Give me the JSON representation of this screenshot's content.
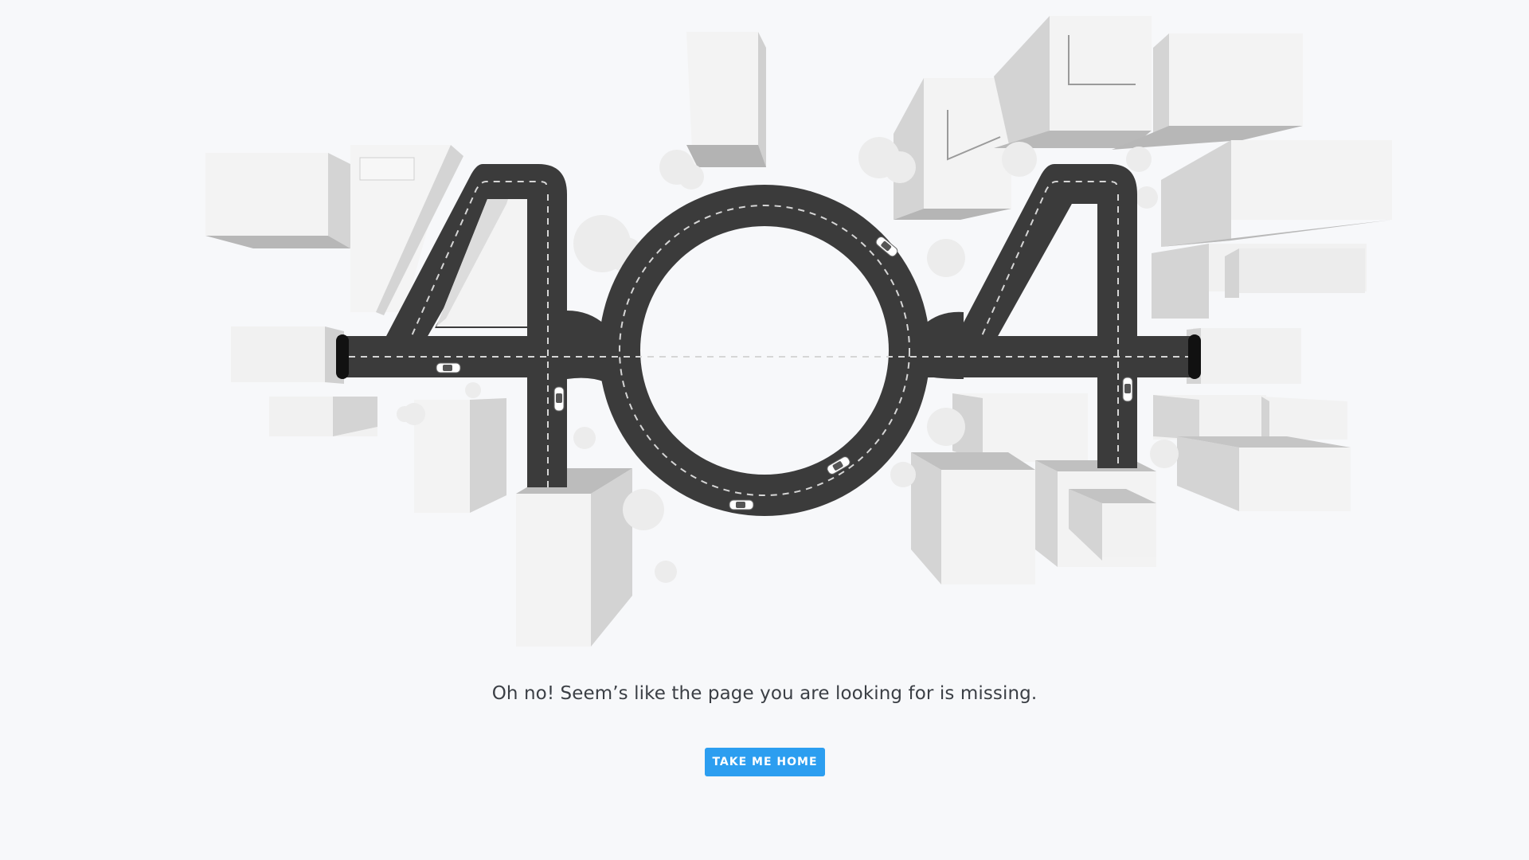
{
  "page": {
    "message": "Oh no! Seem’s like the page you are looking for is missing.",
    "home_button_label": "TAKE ME HOME"
  },
  "illustration": {
    "subject": "404 spelled as roads through a city of blocks with cars",
    "colors": {
      "background": "#f7f8fa",
      "road": "#3b3b3b",
      "road_markings": "#d6d6d6",
      "building_top": "#f2f2f2",
      "building_side": "#d4d4d4",
      "building_shadow": "#b5b5b5",
      "tree": "#ececec",
      "button": "#2c9ef0"
    }
  }
}
